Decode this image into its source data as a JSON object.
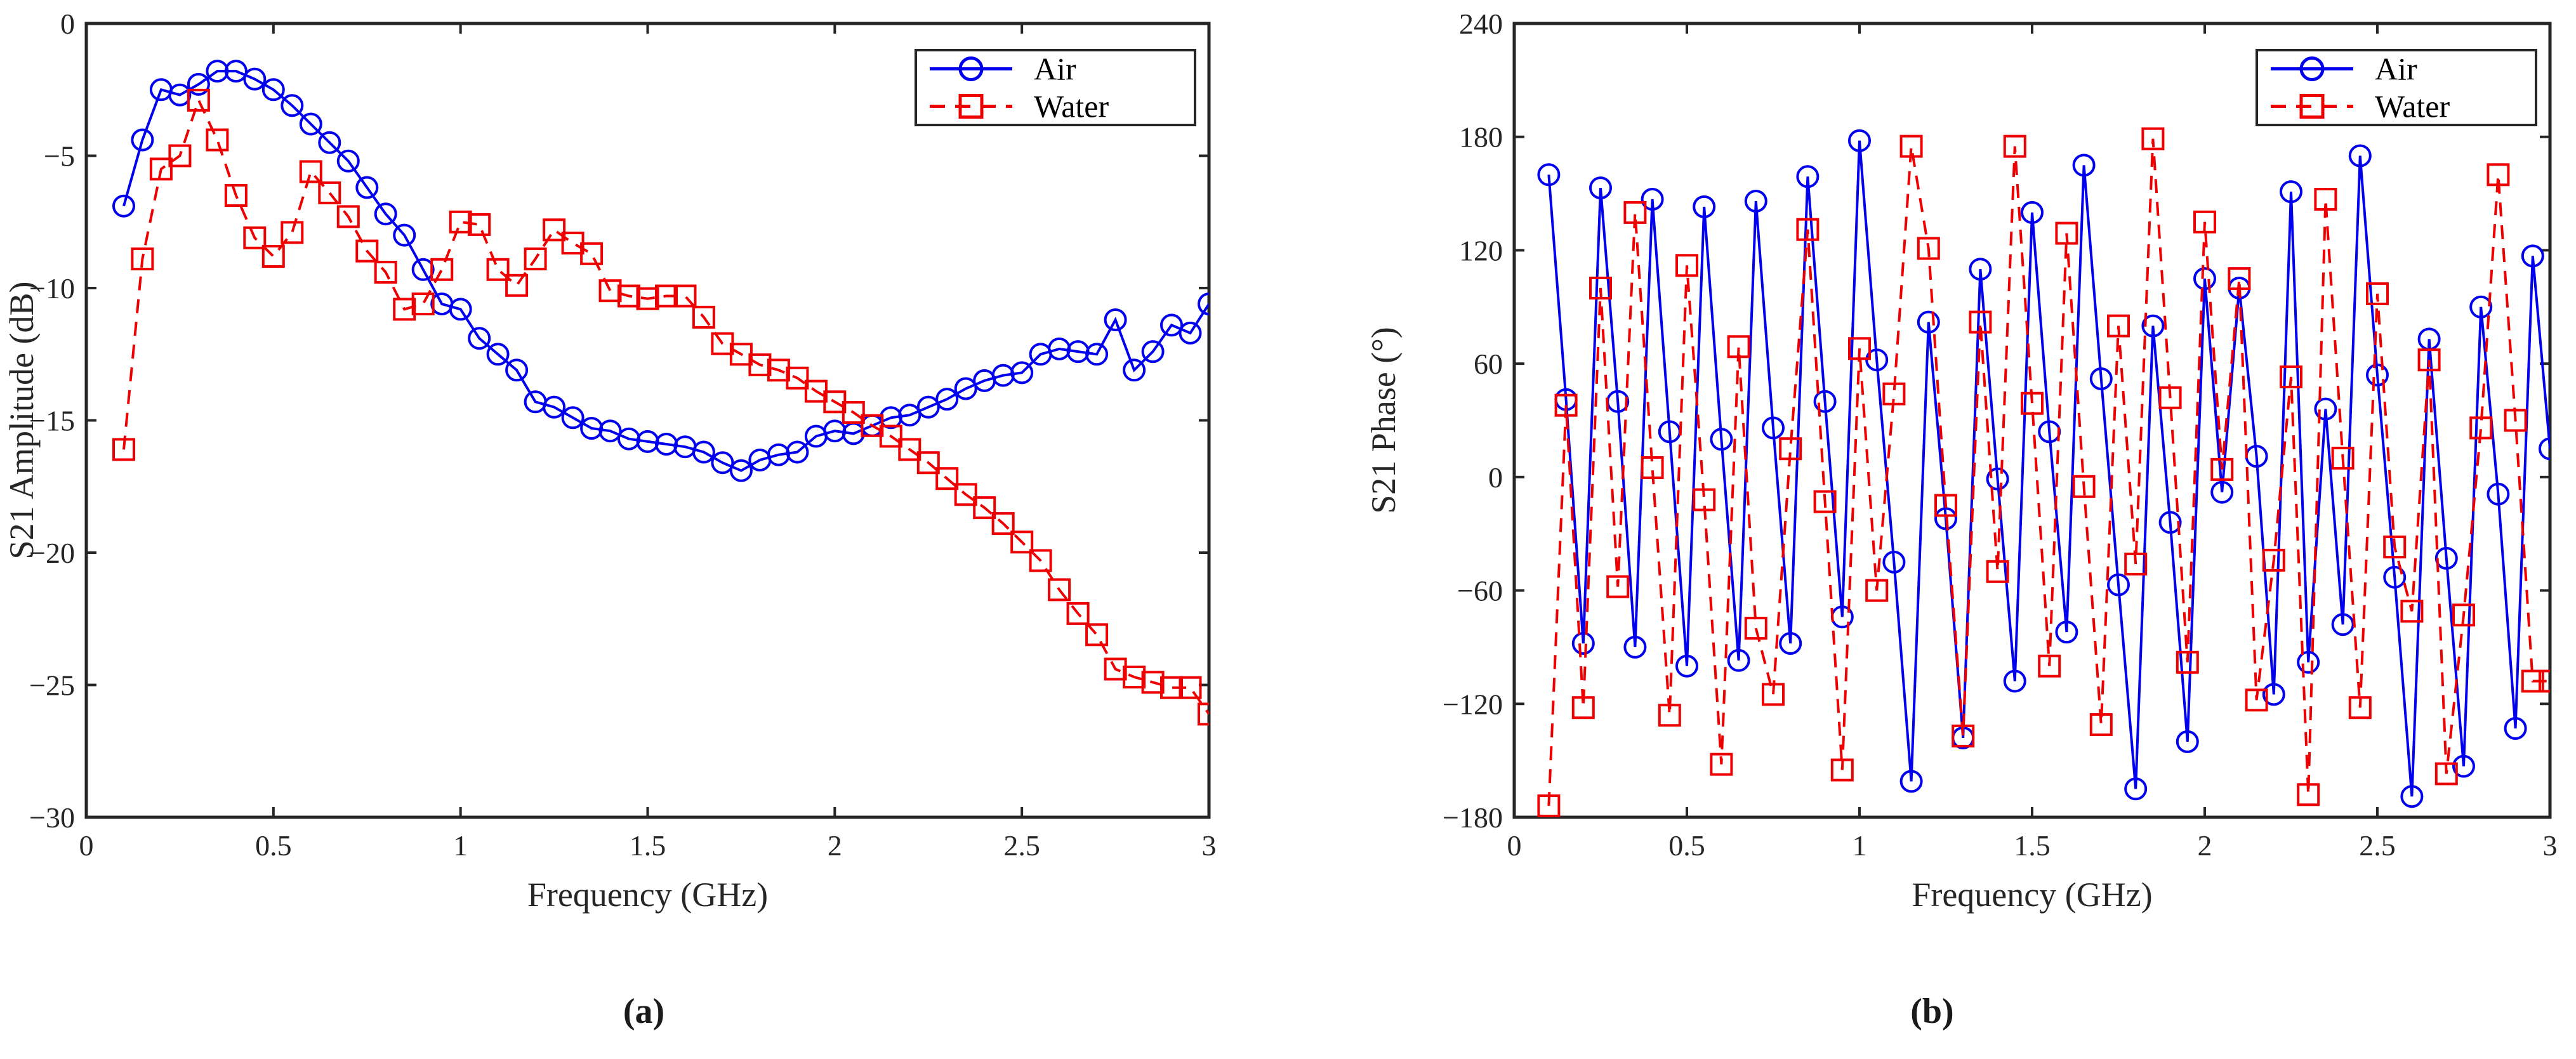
{
  "figure": {
    "panel_a_label": "(a)",
    "panel_b_label": "(b)",
    "colors": {
      "air": "#0000ee",
      "water": "#ee0000",
      "axis": "#262626",
      "background": "#ffffff"
    }
  },
  "chart_data": [
    {
      "type": "line",
      "panel": "(a)",
      "title": "",
      "xlabel": "Frequency (GHz)",
      "ylabel": "S21 Amplitude (dB)",
      "xlim": [
        0,
        3
      ],
      "ylim": [
        -30,
        0
      ],
      "xticks": [
        "0",
        "0.5",
        "1",
        "1.5",
        "2",
        "2.5",
        "3"
      ],
      "xtick_values": [
        0,
        0.5,
        1,
        1.5,
        2,
        2.5,
        3
      ],
      "yticks": [
        "0",
        "−5",
        "−10",
        "−15",
        "−20",
        "−25",
        "−30"
      ],
      "ytick_values": [
        0,
        -5,
        -10,
        -15,
        -20,
        -25,
        -30
      ],
      "grid": false,
      "legend_position": "top-right",
      "legend": [
        "Air",
        "Water"
      ],
      "series": [
        {
          "name": "Air",
          "color": "#0000ee",
          "linestyle": "solid",
          "marker": "circle",
          "x": [
            0.1,
            0.15,
            0.2,
            0.25,
            0.3,
            0.35,
            0.4,
            0.45,
            0.5,
            0.55,
            0.6,
            0.65,
            0.7,
            0.75,
            0.8,
            0.85,
            0.9,
            0.95,
            1.0,
            1.05,
            1.1,
            1.15,
            1.2,
            1.25,
            1.3,
            1.35,
            1.4,
            1.45,
            1.5,
            1.55,
            1.6,
            1.65,
            1.7,
            1.75,
            1.8,
            1.85,
            1.9,
            1.95,
            2.0,
            2.05,
            2.1,
            2.15,
            2.2,
            2.25,
            2.3,
            2.35,
            2.4,
            2.45,
            2.5,
            2.55,
            2.6,
            2.65,
            2.7,
            2.75,
            2.8,
            2.85,
            2.9,
            2.95,
            3.0
          ],
          "y": [
            -6.9,
            -4.4,
            -2.5,
            -2.7,
            -2.3,
            -1.8,
            -1.8,
            -2.1,
            -2.5,
            -3.1,
            -3.8,
            -4.5,
            -5.2,
            -6.2,
            -7.2,
            -8.0,
            -9.3,
            -10.6,
            -10.8,
            -11.9,
            -12.5,
            -13.1,
            -14.3,
            -14.5,
            -14.9,
            -15.3,
            -15.4,
            -15.7,
            -15.8,
            -15.9,
            -16.0,
            -16.2,
            -16.6,
            -16.9,
            -16.5,
            -16.3,
            -16.2,
            -15.6,
            -15.4,
            -15.5,
            -15.2,
            -14.9,
            -14.8,
            -14.5,
            -14.2,
            -13.8,
            -13.5,
            -13.3,
            -13.2,
            -12.5,
            -12.3,
            -12.4,
            -12.5,
            -11.2,
            -13.1,
            -12.4,
            -11.4,
            -11.7,
            -10.6
          ]
        },
        {
          "name": "Water",
          "color": "#ee0000",
          "linestyle": "dashed",
          "marker": "square",
          "x": [
            0.1,
            0.15,
            0.2,
            0.25,
            0.3,
            0.35,
            0.4,
            0.45,
            0.5,
            0.55,
            0.6,
            0.65,
            0.7,
            0.75,
            0.8,
            0.85,
            0.9,
            0.95,
            1.0,
            1.05,
            1.1,
            1.15,
            1.2,
            1.25,
            1.3,
            1.35,
            1.4,
            1.45,
            1.5,
            1.55,
            1.6,
            1.65,
            1.7,
            1.75,
            1.8,
            1.85,
            1.9,
            1.95,
            2.0,
            2.05,
            2.1,
            2.15,
            2.2,
            2.25,
            2.3,
            2.35,
            2.4,
            2.45,
            2.5,
            2.55,
            2.6,
            2.65,
            2.7,
            2.75,
            2.8,
            2.85,
            2.9,
            2.95,
            3.0
          ],
          "y": [
            -16.1,
            -8.9,
            -5.5,
            -5.0,
            -2.9,
            -4.4,
            -6.5,
            -8.1,
            -8.8,
            -7.9,
            -5.6,
            -6.4,
            -7.3,
            -8.6,
            -9.4,
            -10.8,
            -10.6,
            -9.3,
            -7.5,
            -7.6,
            -9.3,
            -9.9,
            -8.9,
            -7.8,
            -8.3,
            -8.7,
            -10.1,
            -10.3,
            -10.4,
            -10.3,
            -10.3,
            -11.1,
            -12.1,
            -12.5,
            -12.9,
            -13.1,
            -13.4,
            -13.9,
            -14.3,
            -14.7,
            -15.2,
            -15.6,
            -16.1,
            -16.6,
            -17.2,
            -17.8,
            -18.3,
            -18.9,
            -19.6,
            -20.3,
            -21.4,
            -22.3,
            -23.1,
            -24.4,
            -24.7,
            -24.9,
            -25.1,
            -25.1,
            -26.1
          ]
        }
      ]
    },
    {
      "type": "line",
      "panel": "(b)",
      "title": "",
      "xlabel": "Frequency (GHz)",
      "ylabel": "S21 Phase (°)",
      "xlim": [
        0,
        3
      ],
      "ylim": [
        -180,
        240
      ],
      "xticks": [
        "0",
        "0.5",
        "1",
        "1.5",
        "2",
        "2.5",
        "3"
      ],
      "xtick_values": [
        0,
        0.5,
        1,
        1.5,
        2,
        2.5,
        3
      ],
      "yticks": [
        "240",
        "180",
        "120",
        "60",
        "0",
        "−60",
        "−120",
        "−180"
      ],
      "ytick_values": [
        240,
        180,
        120,
        60,
        0,
        -60,
        -120,
        -180
      ],
      "grid": false,
      "legend_position": "top-right",
      "legend": [
        "Air",
        "Water"
      ],
      "series": [
        {
          "name": "Air",
          "color": "#0000ee",
          "linestyle": "solid",
          "marker": "circle",
          "x": [
            0.1,
            0.15,
            0.2,
            0.25,
            0.3,
            0.35,
            0.4,
            0.45,
            0.5,
            0.55,
            0.6,
            0.65,
            0.7,
            0.75,
            0.8,
            0.85,
            0.9,
            0.95,
            1.0,
            1.05,
            1.1,
            1.15,
            1.2,
            1.25,
            1.3,
            1.35,
            1.4,
            1.45,
            1.5,
            1.55,
            1.6,
            1.65,
            1.7,
            1.75,
            1.8,
            1.85,
            1.9,
            1.95,
            2.0,
            2.05,
            2.1,
            2.15,
            2.2,
            2.25,
            2.3,
            2.35,
            2.4,
            2.45,
            2.5,
            2.55,
            2.6,
            2.65,
            2.7,
            2.75,
            2.8,
            2.85,
            2.9,
            2.95,
            3.0
          ],
          "y": [
            160,
            41,
            -88,
            153,
            40,
            -90,
            147,
            24,
            -100,
            143,
            20,
            -97,
            146,
            26,
            -88,
            159,
            40,
            -74,
            178,
            62,
            -45,
            -161,
            82,
            -22,
            -138,
            110,
            -1,
            -108,
            140,
            24,
            -82,
            165,
            52,
            -57,
            -165,
            80,
            -24,
            -140,
            105,
            -8,
            100,
            11,
            -115,
            151,
            -98,
            36,
            -78,
            170,
            54,
            -53,
            -169,
            73,
            -43,
            -153,
            90,
            -9,
            -133,
            117,
            15
          ]
        },
        {
          "name": "Water",
          "color": "#ee0000",
          "linestyle": "dashed",
          "marker": "square",
          "x": [
            0.1,
            0.15,
            0.2,
            0.25,
            0.3,
            0.35,
            0.4,
            0.45,
            0.5,
            0.55,
            0.6,
            0.65,
            0.7,
            0.75,
            0.8,
            0.85,
            0.9,
            0.95,
            1.0,
            1.05,
            1.1,
            1.15,
            1.2,
            1.25,
            1.3,
            1.35,
            1.4,
            1.45,
            1.5,
            1.55,
            1.6,
            1.65,
            1.7,
            1.75,
            1.8,
            1.85,
            1.9,
            1.95,
            2.0,
            2.05,
            2.1,
            2.15,
            2.2,
            2.25,
            2.3,
            2.35,
            2.4,
            2.45,
            2.5,
            2.55,
            2.6,
            2.65,
            2.7,
            2.75,
            2.8,
            2.85,
            2.9,
            2.95,
            3.0
          ],
          "y": [
            -174,
            38,
            -122,
            100,
            -58,
            140,
            5,
            -126,
            112,
            -12,
            -152,
            69,
            -80,
            -115,
            15,
            131,
            -13,
            -155,
            68,
            -60,
            44,
            175,
            121,
            -15,
            -137,
            82,
            -50,
            175,
            39,
            -100,
            129,
            -5,
            -131,
            80,
            -46,
            179,
            42,
            -98,
            135,
            4,
            105,
            -118,
            -44,
            53,
            -168,
            147,
            10,
            -122,
            97,
            -37,
            -71,
            62,
            -157,
            -73,
            26,
            160,
            30,
            -108,
            -108
          ]
        }
      ]
    }
  ]
}
